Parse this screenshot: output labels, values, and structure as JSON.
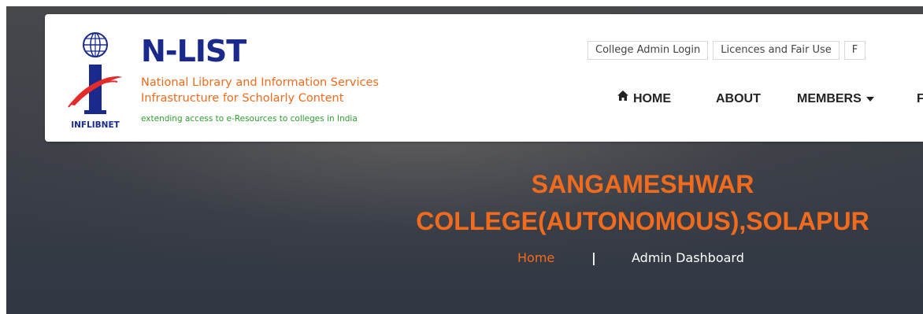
{
  "brand": {
    "logo_text": "INFLIBNET",
    "name": "N-LIST",
    "line1": "National Library and Information Services",
    "line2": "Infrastructure for Scholarly Content",
    "tagline": "extending access to e-Resources to colleges in India"
  },
  "top_links": [
    {
      "label": "College Admin Login"
    },
    {
      "label": "Licences and Fair Use"
    },
    {
      "label": "F"
    }
  ],
  "nav": {
    "home": "HOME",
    "about": "ABOUT",
    "members": "MEMBERS",
    "next_partial": "F"
  },
  "hero": {
    "title_line1": "SANGAMESHWAR",
    "title_line2": "COLLEGE(AUTONOMOUS),SOLAPUR"
  },
  "breadcrumb": {
    "home": "Home",
    "separator": "|",
    "current": "Admin Dashboard"
  },
  "colors": {
    "accent_orange": "#f26b1d",
    "brand_blue": "#1a2a8c",
    "tagline_green": "#2e9e2e",
    "hero_background": "#3d4047"
  },
  "icons": {
    "home": "home-icon",
    "members_dropdown": "caret-down-icon",
    "logo": "inflibnet-logo"
  }
}
